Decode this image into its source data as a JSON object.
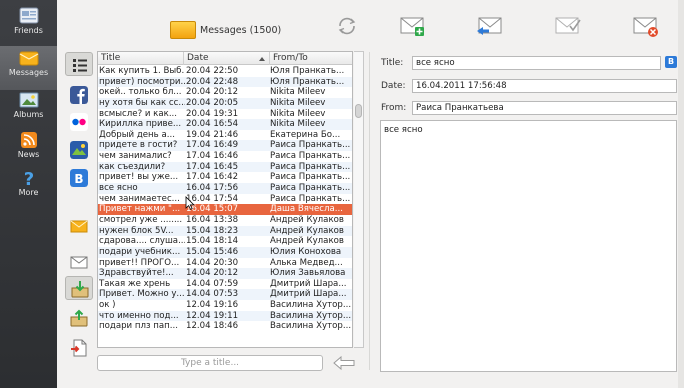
{
  "nav": [
    {
      "label": "Friends",
      "icon": "friends-icon"
    },
    {
      "label": "Messages",
      "icon": "messages-icon"
    },
    {
      "label": "Albums",
      "icon": "albums-icon"
    },
    {
      "label": "News",
      "icon": "rss-icon"
    },
    {
      "label": "More",
      "icon": "question-icon"
    }
  ],
  "header": {
    "title": "Messages (1500)"
  },
  "table": {
    "columns": [
      "Title",
      "Date",
      "From/To"
    ],
    "sort_column": "Date",
    "sort_direction": "descending",
    "selected_index": 13,
    "rows": [
      {
        "title": "Как купить 1. Выб...",
        "date": "20.04 22:50",
        "from": "Юля Пранкать..."
      },
      {
        "title": "привет) посмотри...",
        "date": "20.04 22:48",
        "from": "Юля Пранкать..."
      },
      {
        "title": "окей.. только бл...",
        "date": "20.04 20:12",
        "from": "Nikita Mileev"
      },
      {
        "title": "ну хотя бы как сс...",
        "date": "20.04 20:05",
        "from": "Nikita Mileev"
      },
      {
        "title": "всмысле? и как...",
        "date": "20.04 19:31",
        "from": "Nikita Mileev"
      },
      {
        "title": "Кириллка приве...",
        "date": "20.04 16:54",
        "from": "Nikita Mileev"
      },
      {
        "title": "Добрый день а...",
        "date": "19.04 21:46",
        "from": "Екатерина Бо..."
      },
      {
        "title": "придете в гости?",
        "date": "17.04 16:49",
        "from": "Раиса Пранкать..."
      },
      {
        "title": "чем занималис?",
        "date": "17.04 16:46",
        "from": "Раиса Пранкать..."
      },
      {
        "title": "как съездили?",
        "date": "17.04 16:45",
        "from": "Раиса Пранкать..."
      },
      {
        "title": "привет! вы уже...",
        "date": "17.04 16:42",
        "from": "Раиса Пранкать..."
      },
      {
        "title": "все ясно",
        "date": "16.04 17:56",
        "from": "Раиса Пранкать..."
      },
      {
        "title": "чем занимаетес...",
        "date": "16.04 17:54",
        "from": "Раиса Пранкать..."
      },
      {
        "title": "Привет нажми \"...",
        "date": "16.04 15:07",
        "from": "Даша Вячесла..."
      },
      {
        "title": "смотрел уже ........",
        "date": "16.04 13:38",
        "from": "Андрей Кулаков"
      },
      {
        "title": "нужен блок 5V...",
        "date": "15.04 18:23",
        "from": "Андрей Кулаков"
      },
      {
        "title": "сдарова.... слуша...",
        "date": "15.04 18:14",
        "from": "Андрей Кулаков"
      },
      {
        "title": "подари учебник...",
        "date": "15.04 15:46",
        "from": "Юлия Конохова"
      },
      {
        "title": "привет!! ПРОГО...",
        "date": "14.04 20:30",
        "from": "Алька Медвед..."
      },
      {
        "title": "Здравствуйте!...",
        "date": "14.04 20:12",
        "from": "Юлия Завьялова"
      },
      {
        "title": "Такая же хрень",
        "date": "14.04 07:59",
        "from": "Дмитрий Шара..."
      },
      {
        "title": "Привет. Можно у...",
        "date": "14.04 07:53",
        "from": "Дмитрий Шара..."
      },
      {
        "title": "ок )",
        "date": "12.04 19:16",
        "from": "Василина Хутор..."
      },
      {
        "title": "что именно под...",
        "date": "12.04 19:11",
        "from": "Василина Хутор..."
      },
      {
        "title": "подари плз пап...",
        "date": "12.04 18:46",
        "from": "Василина Хутор..."
      }
    ]
  },
  "title_input": {
    "placeholder": "Type a title..."
  },
  "detail": {
    "title_label": "Title:",
    "title_value": "все ясно",
    "date_label": "Date:",
    "date_value": "16.04.2011 17:56:48",
    "from_label": "From:",
    "from_value": "Раиса Пранкатьева",
    "body": "все ясно",
    "b_button": "B"
  },
  "colors": {
    "selected_row": "#e8653e",
    "nav_bg": "#2c2e31",
    "accent_blue": "#2d7ad8"
  }
}
